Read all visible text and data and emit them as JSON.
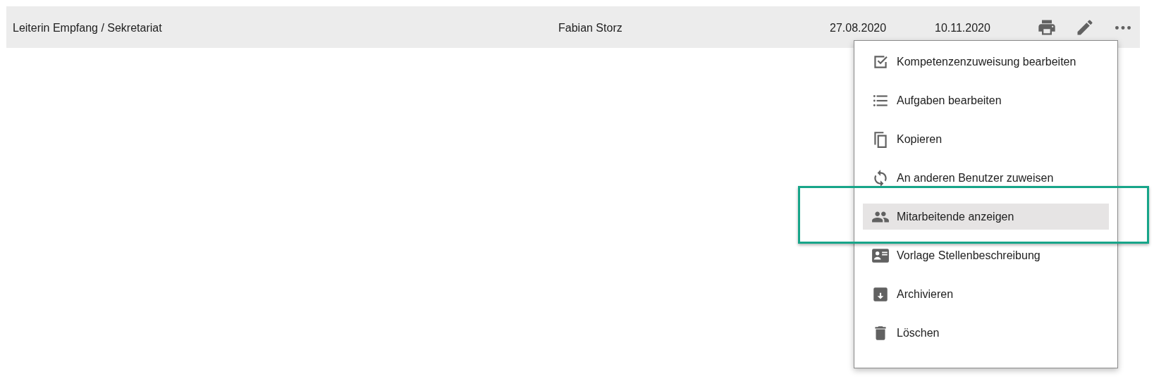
{
  "row": {
    "title": "Leiterin Empfang / Sekretariat",
    "person": "Fabian Storz",
    "date_1": "27.08.2020",
    "date_2": "10.11.2020",
    "actions": [
      {
        "kind": "print"
      },
      {
        "kind": "edit"
      },
      {
        "kind": "more"
      }
    ]
  },
  "menu": {
    "items": [
      {
        "kind": "checkbox",
        "label": "Kompetenzenzuweisung bearbeiten",
        "selected": false,
        "framed": false
      },
      {
        "kind": "list",
        "label": "Aufgaben bearbeiten",
        "selected": false,
        "framed": false
      },
      {
        "kind": "copy",
        "label": "Kopieren",
        "selected": false,
        "framed": false
      },
      {
        "kind": "reassign",
        "label": "An anderen Benutzer zuweisen",
        "selected": false,
        "framed": false
      },
      {
        "kind": "people",
        "label": "Mitarbeitende anzeigen",
        "selected": true,
        "framed": true
      },
      {
        "kind": "card",
        "label": "Vorlage Stellenbeschreibung",
        "selected": false,
        "framed": false
      },
      {
        "kind": "archive",
        "label": "Archivieren",
        "selected": false,
        "framed": false
      },
      {
        "kind": "trash",
        "label": "Löschen",
        "selected": false,
        "framed": false
      }
    ]
  }
}
